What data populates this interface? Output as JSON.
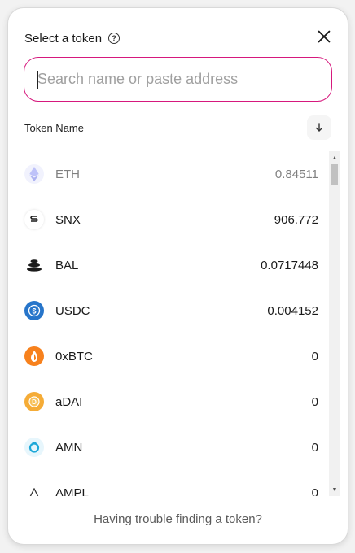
{
  "header": {
    "title": "Select a token",
    "help_icon": "question-circle-icon",
    "close_icon": "close-icon"
  },
  "search": {
    "placeholder": "Search name or paste address",
    "value": "",
    "border_color": "#d6187d"
  },
  "list_header": {
    "column_label": "Token Name",
    "sort_icon": "arrow-down-icon"
  },
  "tokens": [
    {
      "symbol": "ETH",
      "balance": "0.84511",
      "icon": "eth-icon",
      "color": "#8a92f5",
      "dimmed": true
    },
    {
      "symbol": "SNX",
      "balance": "906.772",
      "icon": "snx-icon",
      "color": "#1a1a1a",
      "dimmed": false
    },
    {
      "symbol": "BAL",
      "balance": "0.0717448",
      "icon": "bal-icon",
      "color": "#1a1a1a",
      "dimmed": false
    },
    {
      "symbol": "USDC",
      "balance": "0.004152",
      "icon": "usdc-icon",
      "color": "#2775ca",
      "dimmed": false
    },
    {
      "symbol": "0xBTC",
      "balance": "0",
      "icon": "0xbtc-icon",
      "color": "#f7811d",
      "dimmed": false
    },
    {
      "symbol": "aDAI",
      "balance": "0",
      "icon": "adai-icon",
      "color": "#f5ac37",
      "dimmed": false
    },
    {
      "symbol": "AMN",
      "balance": "0",
      "icon": "amn-icon",
      "color": "#1ea8d8",
      "dimmed": false
    },
    {
      "symbol": "AMPL",
      "balance": "0",
      "icon": "ampl-icon",
      "color": "#333333",
      "dimmed": false
    }
  ],
  "footer": {
    "link_text": "Having trouble finding a token?"
  }
}
